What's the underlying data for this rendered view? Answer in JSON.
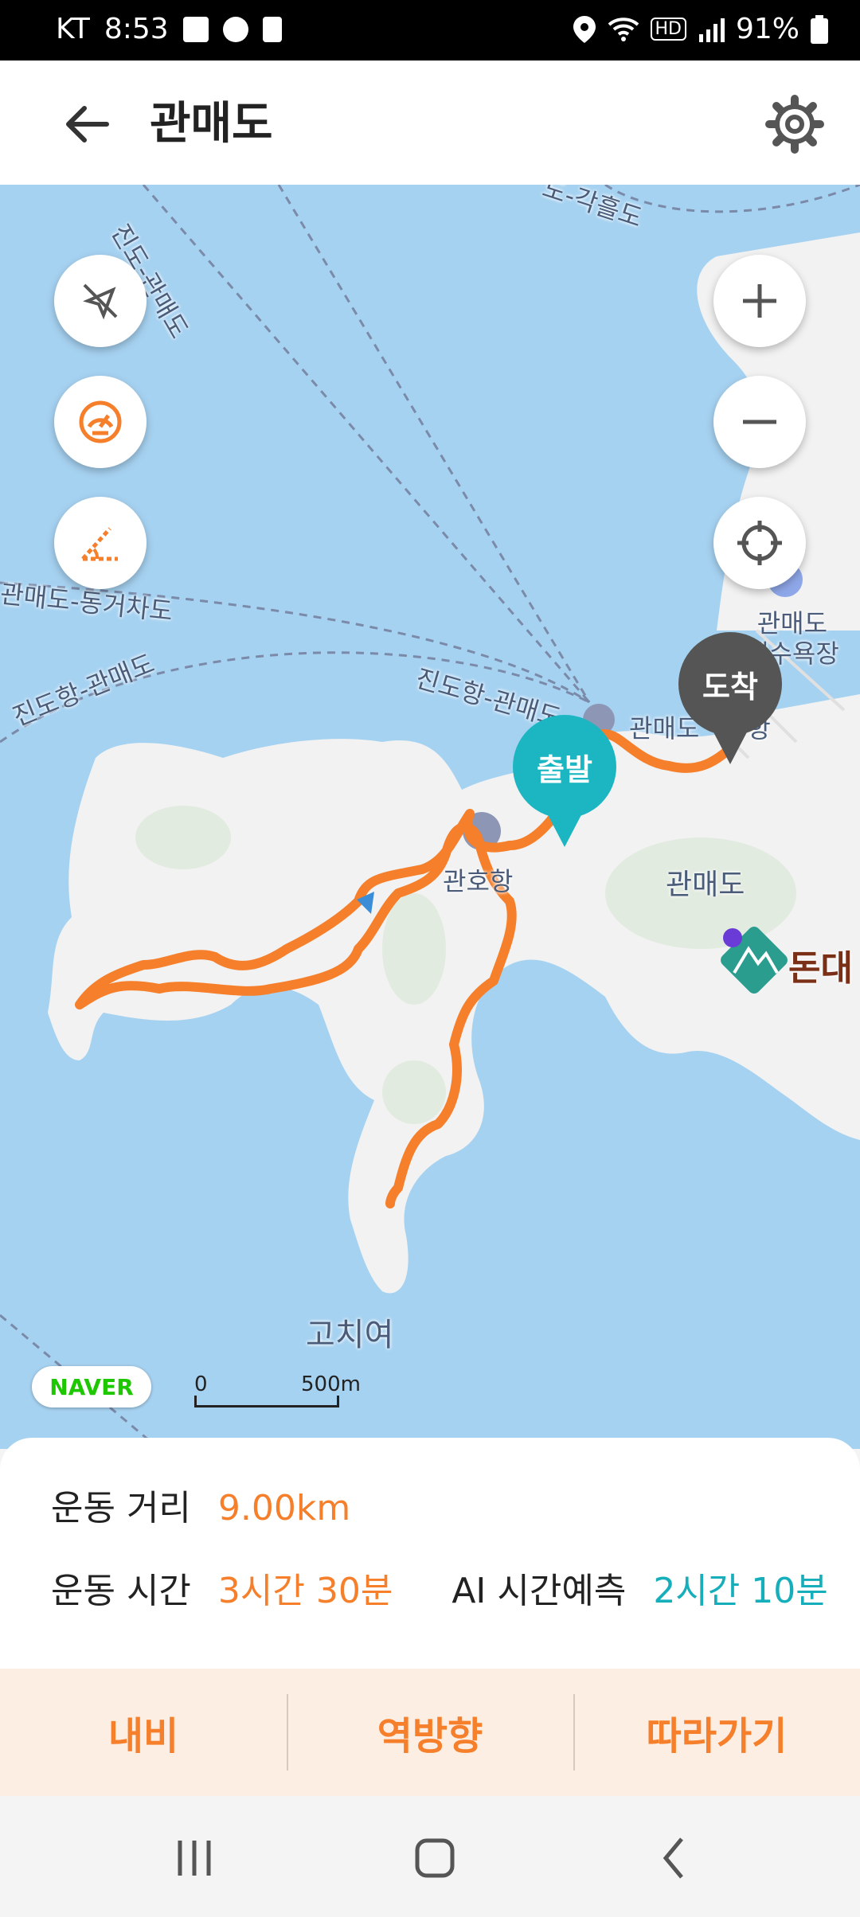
{
  "status_bar": {
    "carrier": "KT",
    "time": "8:53",
    "battery": "91%",
    "network_badge": "HD",
    "icons": [
      "image-icon",
      "steps-icon",
      "sd-card-icon",
      "location-icon",
      "wifi-icon",
      "signal-icon",
      "battery-icon"
    ]
  },
  "header": {
    "title": "관매도",
    "back_icon": "arrow-left-icon",
    "settings_icon": "gear-icon"
  },
  "map": {
    "controls": {
      "left": [
        "compass-off-icon",
        "speedometer-icon",
        "slope-icon"
      ],
      "right": [
        "zoom-in-icon",
        "zoom-out-icon",
        "locate-icon"
      ]
    },
    "start_pin": "출발",
    "end_pin": "도착",
    "labels": {
      "ferry_1": "진도-관매도",
      "ferry_2": "도-각흘도",
      "ferry_3": "관매도-동거차도",
      "ferry_4": "진도항-관매도",
      "ferry_5": "진도항-관매도",
      "beach": "관매도\n해수욕장",
      "port_1": "관매도",
      "port_1_suffix": "항",
      "port_2": "관호항",
      "island": "관매도",
      "poi": "돈대",
      "reef": "고치여"
    },
    "naver_logo": "NAVER",
    "scale": {
      "start": "0",
      "end": "500m"
    }
  },
  "stats": {
    "distance_label": "운동 거리",
    "distance_value": "9.00km",
    "time_label": "운동 시간",
    "time_value": "3시간 30분",
    "ai_label": "AI 시간예측",
    "ai_value": "2시간 10분"
  },
  "actions": {
    "navigate": "내비",
    "reverse": "역방향",
    "follow": "따라가기"
  },
  "colors": {
    "route": "#f57f2a",
    "start_pin": "#1bb6c2",
    "end_pin": "#555555",
    "water": "#a6d2f1",
    "land": "#f2f2f2"
  }
}
